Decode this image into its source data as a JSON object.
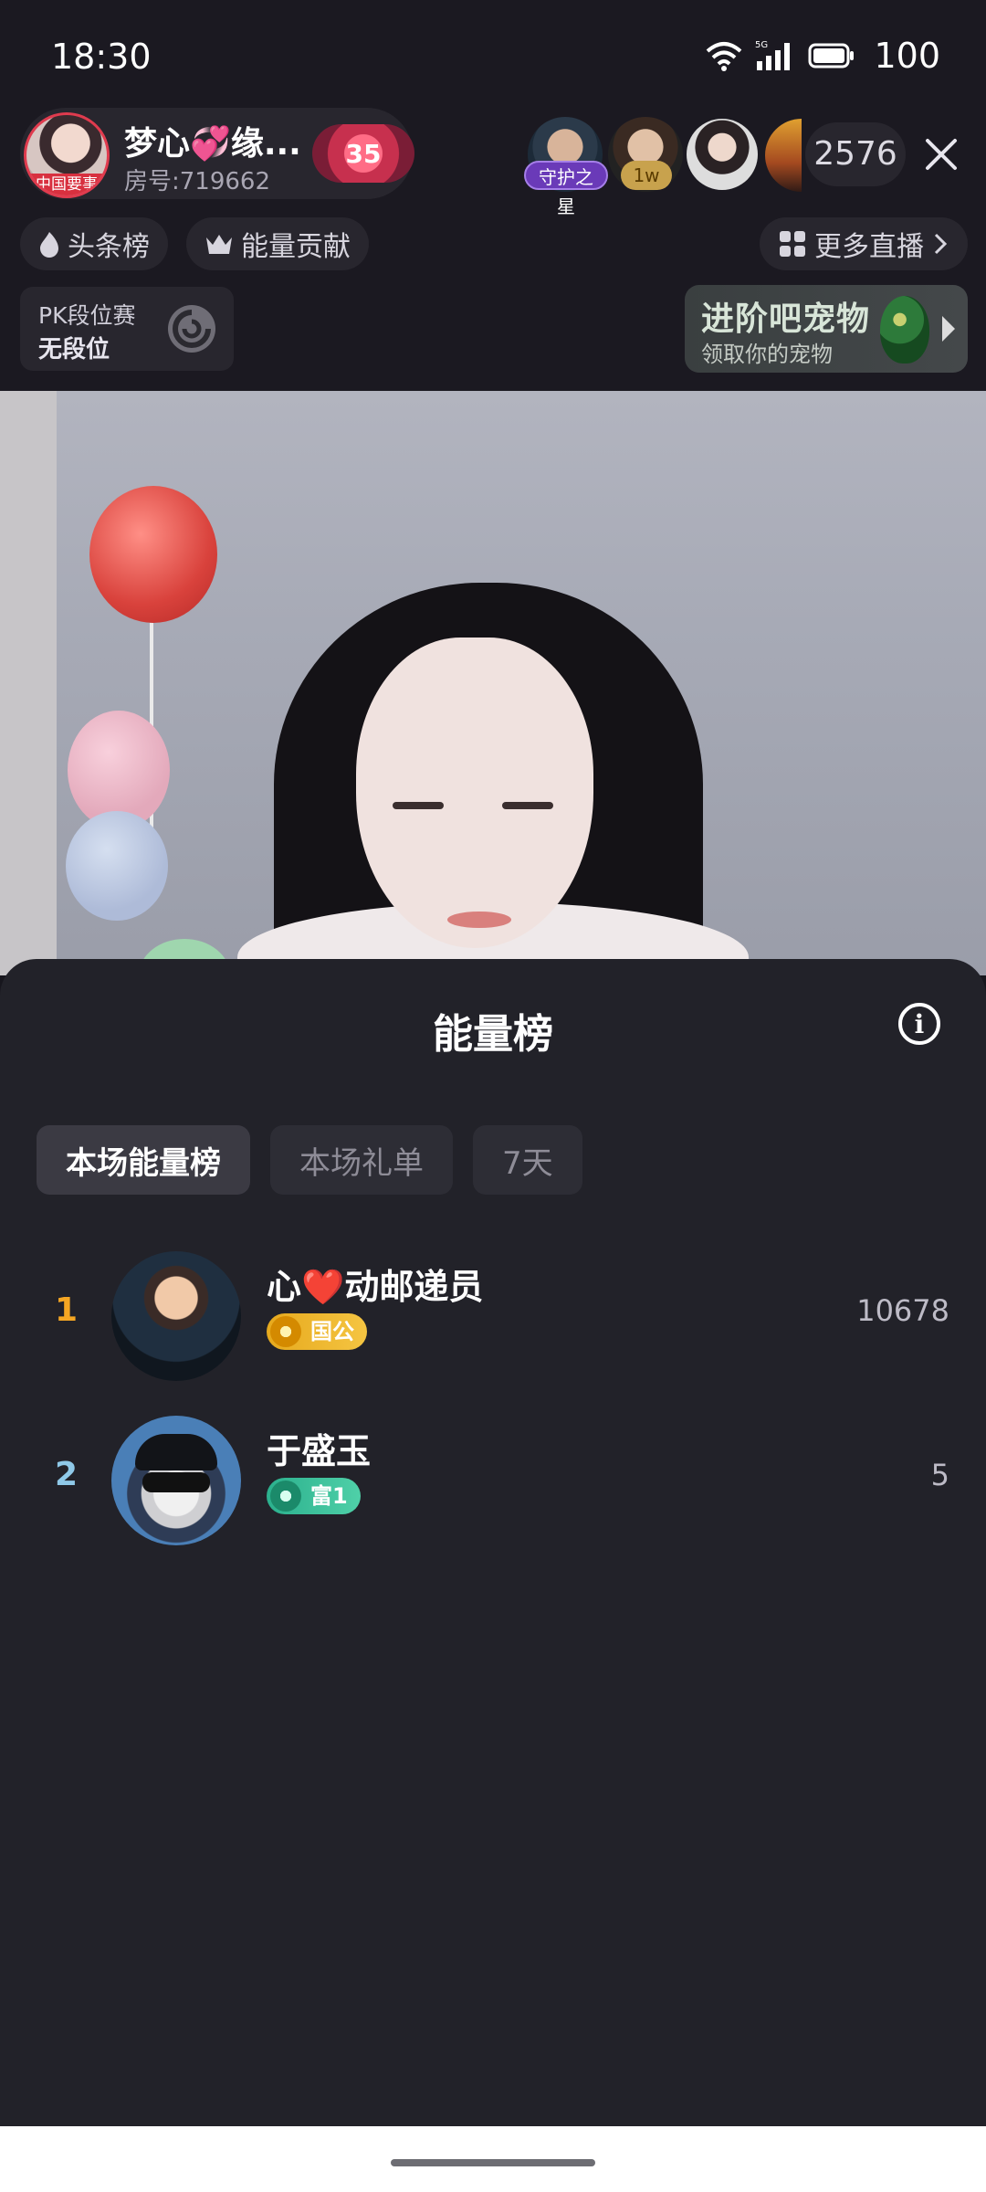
{
  "status_bar": {
    "time": "18:30",
    "battery": "100",
    "network": "5G"
  },
  "host": {
    "name": "梦心💞缘...",
    "room": "房号:719662",
    "avatar_tag": "中国要事",
    "likes": "35"
  },
  "viewers": {
    "badge_guard": "守护之星",
    "badge_1w": "1w",
    "online_count": "2576"
  },
  "chips": {
    "headline": "头条榜",
    "energy_contrib": "能量贡献",
    "more_live": "更多直播"
  },
  "pk": {
    "title": "PK段位赛",
    "rank": "无段位"
  },
  "pet": {
    "title": "进阶吧宠物",
    "subtitle": "领取你的宠物"
  },
  "sheet": {
    "title": "能量榜",
    "info_icon": "i",
    "tabs": [
      {
        "label": "本场能量榜",
        "active": true
      },
      {
        "label": "本场礼单",
        "active": false
      },
      {
        "label": "7天",
        "active": false
      }
    ],
    "ranking": [
      {
        "rank": "1",
        "name": "心❤️动邮递员",
        "badge": "国公",
        "score": "10678",
        "rank_color": "#f5a623",
        "badge_color": "#e6a91d"
      },
      {
        "rank": "2",
        "name": "于盛玉",
        "badge": "富1",
        "score": "5",
        "rank_color": "#8fc9e8",
        "badge_color": "#2bb08d"
      }
    ]
  },
  "colors": {
    "accent_like": "#c7304e",
    "guard_purple": "#6a3ab8",
    "gold": "#e6a91d",
    "teal": "#2bb08d"
  }
}
